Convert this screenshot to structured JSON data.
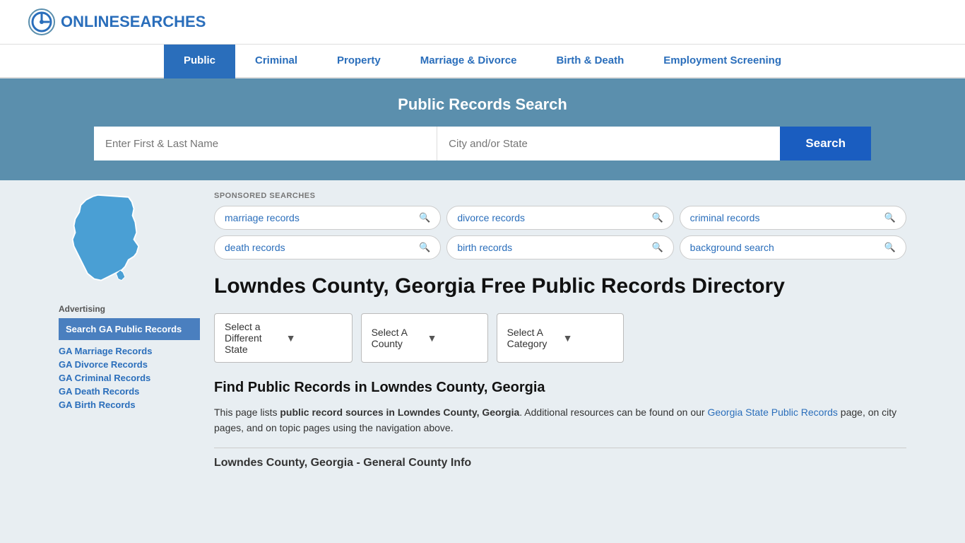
{
  "header": {
    "logo_text_plain": "ONLINE",
    "logo_text_accent": "SEARCHES"
  },
  "nav": {
    "items": [
      {
        "label": "Public",
        "active": true
      },
      {
        "label": "Criminal",
        "active": false
      },
      {
        "label": "Property",
        "active": false
      },
      {
        "label": "Marriage & Divorce",
        "active": false
      },
      {
        "label": "Birth & Death",
        "active": false
      },
      {
        "label": "Employment Screening",
        "active": false
      }
    ]
  },
  "search_banner": {
    "title": "Public Records Search",
    "name_placeholder": "Enter First & Last Name",
    "location_placeholder": "City and/or State",
    "button_label": "Search"
  },
  "sponsored": {
    "label": "SPONSORED SEARCHES",
    "tags": [
      {
        "label": "marriage records"
      },
      {
        "label": "divorce records"
      },
      {
        "label": "criminal records"
      },
      {
        "label": "death records"
      },
      {
        "label": "birth records"
      },
      {
        "label": "background search"
      }
    ]
  },
  "directory": {
    "page_title": "Lowndes County, Georgia Free Public Records Directory",
    "state_label": "Georgia",
    "dropdowns": {
      "state": "Select a Different State",
      "county": "Select A County",
      "category": "Select A Category"
    },
    "find_title": "Find Public Records in Lowndes County, Georgia",
    "find_description_1": "This page lists ",
    "find_bold": "public record sources in Lowndes County, Georgia",
    "find_description_2": ". Additional resources can be found on our ",
    "find_link_text": "Georgia State Public Records",
    "find_description_3": " page, on city pages, and on topic pages using the navigation above.",
    "county_info_label": "Lowndes County, Georgia - General County Info"
  },
  "sidebar": {
    "ad_label": "Advertising",
    "ad_main_label": "Search GA Public Records",
    "ad_links": [
      {
        "label": "GA Marriage Records"
      },
      {
        "label": "GA Divorce Records"
      },
      {
        "label": "GA Criminal Records"
      },
      {
        "label": "GA Death Records"
      },
      {
        "label": "GA Birth Records"
      }
    ]
  }
}
